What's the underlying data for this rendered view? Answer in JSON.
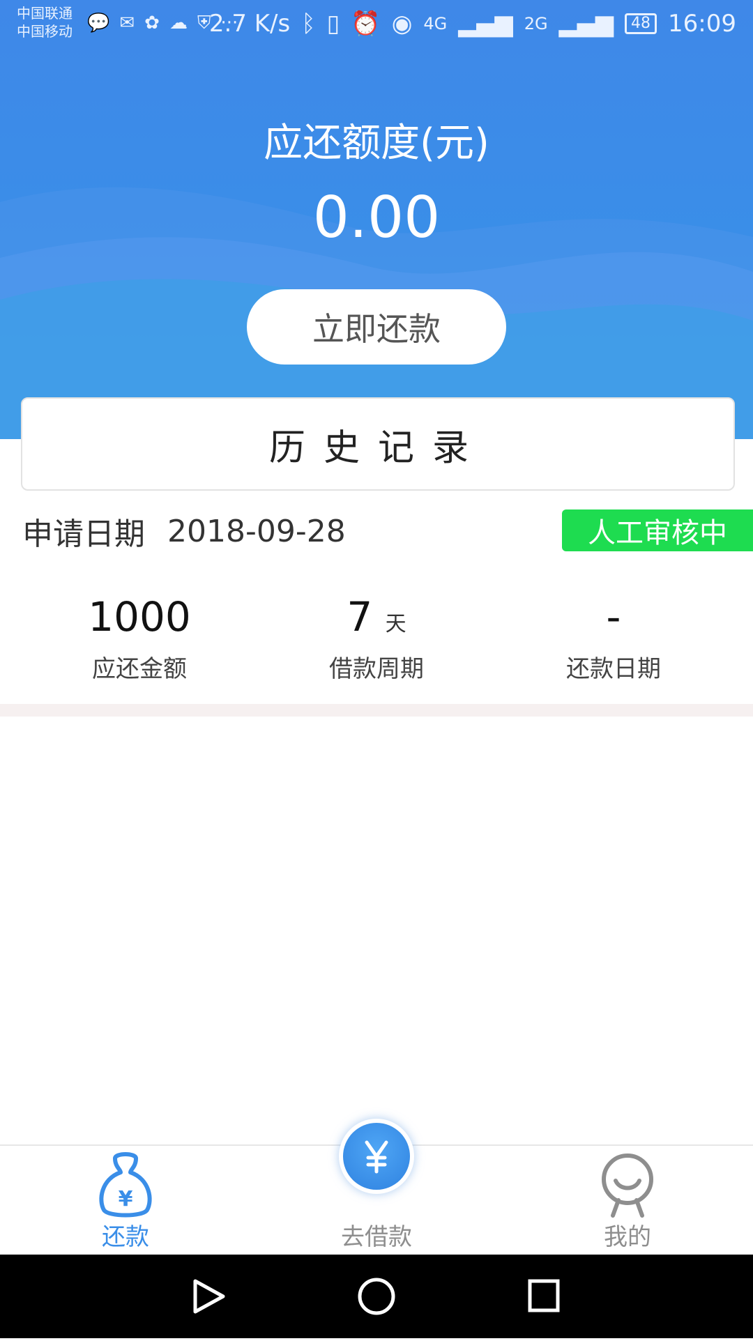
{
  "status_bar": {
    "carrier_1": "中国联通",
    "carrier_2": "中国移动",
    "speed": "2.7 K/s",
    "network_1": "4G",
    "network_2": "2G",
    "battery": "48",
    "time": "16:09",
    "more": "···"
  },
  "header": {
    "title": "应还额度(元)",
    "amount": "0.00",
    "repay_button": "立即还款"
  },
  "history": {
    "label": "历史记录"
  },
  "record": {
    "apply_label": "申请日期",
    "apply_date": "2018-09-28",
    "status": "人工审核中",
    "stats": [
      {
        "value": "1000",
        "unit": "",
        "label": "应还金额"
      },
      {
        "value": "7",
        "unit": "天",
        "label": "借款周期"
      },
      {
        "value": "-",
        "unit": "",
        "label": "还款日期"
      }
    ]
  },
  "bottom_nav": {
    "items": [
      {
        "label": "还款",
        "icon": "money-bag-icon",
        "active": true
      },
      {
        "label": "去借款",
        "icon": "yen-coin-icon",
        "active": false
      },
      {
        "label": "我的",
        "icon": "profile-icon",
        "active": false
      }
    ]
  },
  "colors": {
    "primary": "#3f88e8",
    "active_tab": "#3a8ee8",
    "inactive_tab": "#8e8e8e",
    "status_badge": "#1edc50"
  }
}
